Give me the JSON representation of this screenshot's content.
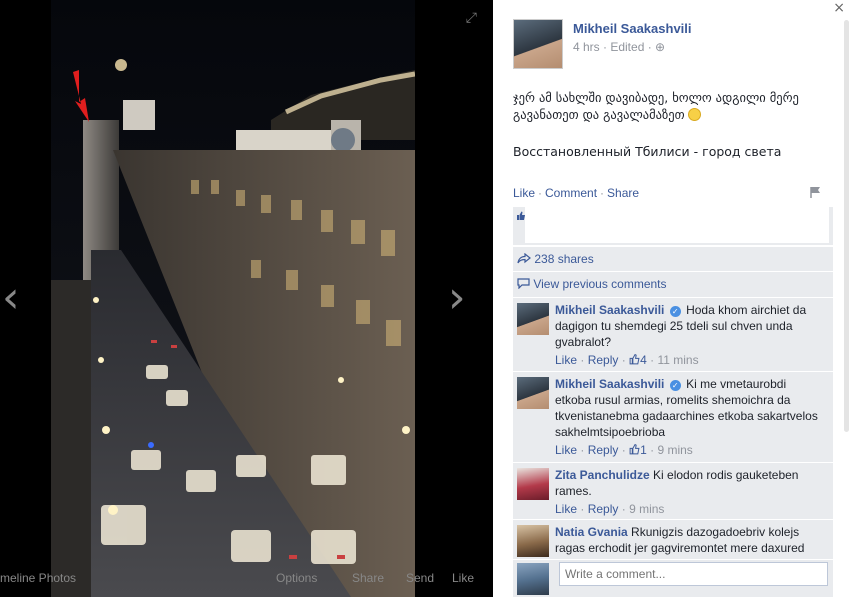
{
  "stage": {
    "nav_prev_glyph": "‹",
    "nav_next_glyph": "›",
    "fullscreen_glyph": "⤢",
    "bar": {
      "timeline": "meline Photos",
      "options": "Options",
      "share": "Share",
      "send": "Send",
      "like": "Like"
    }
  },
  "post": {
    "author": "Mikheil Saakashvili",
    "meta": "4 hrs · Edited · ",
    "globe_glyph": "⊕",
    "text_line1": "ჯერ ამ სახლში დავიბადე, ხოლო ადგილი მერე გავანათეთ და გავალამაზეთ",
    "text_line2": "Восстановленный Тбилиси - город света",
    "actions": {
      "like": "Like",
      "comment": "Comment",
      "share": "Share"
    },
    "shares": "238 shares",
    "view_previous": "View previous comments"
  },
  "comments": [
    {
      "name": "Mikheil Saakashvili",
      "verified": true,
      "text": "Hoda khom airchiet da dagigon tu shemdegi 25 tdeli sul chven unda gvabralot?",
      "like": "Like",
      "reply": "Reply",
      "likes": "4",
      "time": "11 mins"
    },
    {
      "name": "Mikheil Saakashvili",
      "verified": true,
      "text": "Ki me vmetaurobdi etkoba rusul armias, romelits shemoichra da tkvenistanebma gadaarchines etkoba sakartvelos sakhelmtsipoebrioba",
      "like": "Like",
      "reply": "Reply",
      "likes": "1",
      "time": "9 mins"
    },
    {
      "name": "Zita Panchulidze",
      "verified": false,
      "text": "Ki elodon rodis gauketeben rames.",
      "like": "Like",
      "reply": "Reply",
      "time": "9 mins"
    },
    {
      "name": "Natia Gvania",
      "verified": false,
      "text": "Rkunigzis dazogadoebriv kolejs ragas erchodit jer gagviremontet mere daxured"
    }
  ],
  "composer": {
    "placeholder": "Write a comment..."
  },
  "close_glyph": "×",
  "colors": {
    "link": "#3b5998",
    "panel_bg": "#e9ebee",
    "stage_bg": "#000000"
  }
}
